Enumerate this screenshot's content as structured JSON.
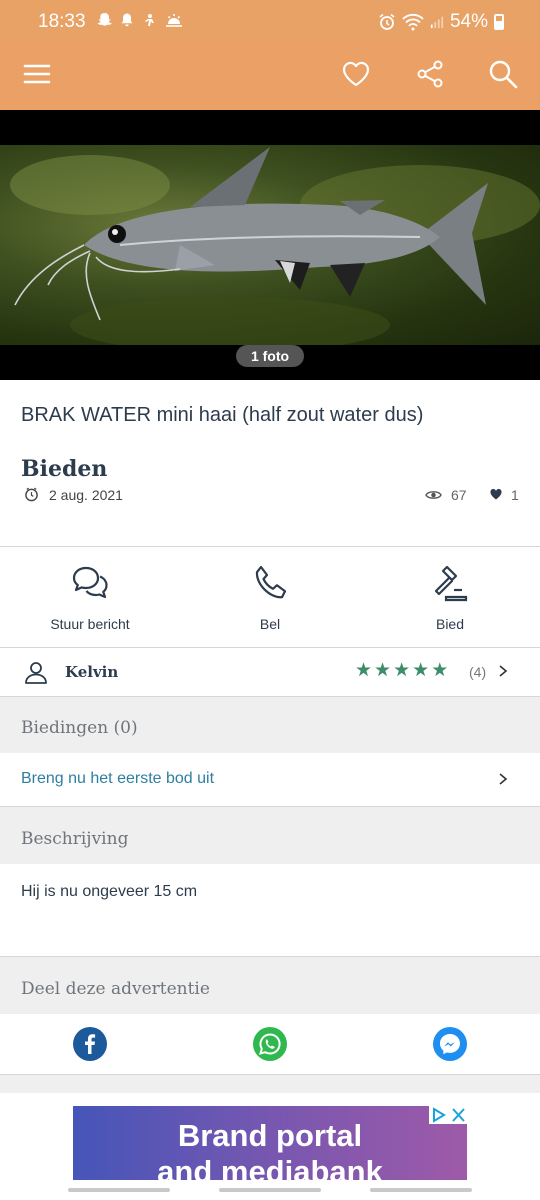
{
  "status_bar": {
    "time": "18:33",
    "battery": "54%"
  },
  "app_bar": {
    "icons": [
      "menu-icon",
      "heart-icon",
      "share-icon",
      "search-icon"
    ],
    "brand_color": "#eba165"
  },
  "listing": {
    "photo_count": "1 foto",
    "title": "BRAK WATER mini haai (half zout water dus)",
    "price": "Bieden",
    "date": "2 aug. 2021",
    "views": "67",
    "favorites": "1"
  },
  "actions": [
    {
      "label": "Stuur bericht",
      "icon": "chat-icon"
    },
    {
      "label": "Bel",
      "icon": "phone-icon"
    },
    {
      "label": "Bied",
      "icon": "gavel-icon"
    }
  ],
  "seller": {
    "name": "Kelvin",
    "rating": 5,
    "review_count": "(4)"
  },
  "bids": {
    "heading": "Biedingen (0)",
    "link": "Breng nu het eerste bod uit"
  },
  "description": {
    "heading": "Beschrijving",
    "text": "Hij is nu ongeveer 15 cm"
  },
  "share": {
    "heading": "Deel deze advertentie",
    "icons": [
      "facebook-icon",
      "whatsapp-icon",
      "messenger-icon"
    ]
  },
  "ad": {
    "line1": "Brand portal",
    "line2": "and mediabank"
  },
  "colors": {
    "accent": "#eba165",
    "link": "#2e7fa0",
    "stars": "#3d8c6a",
    "text": "#2d3c4d"
  }
}
